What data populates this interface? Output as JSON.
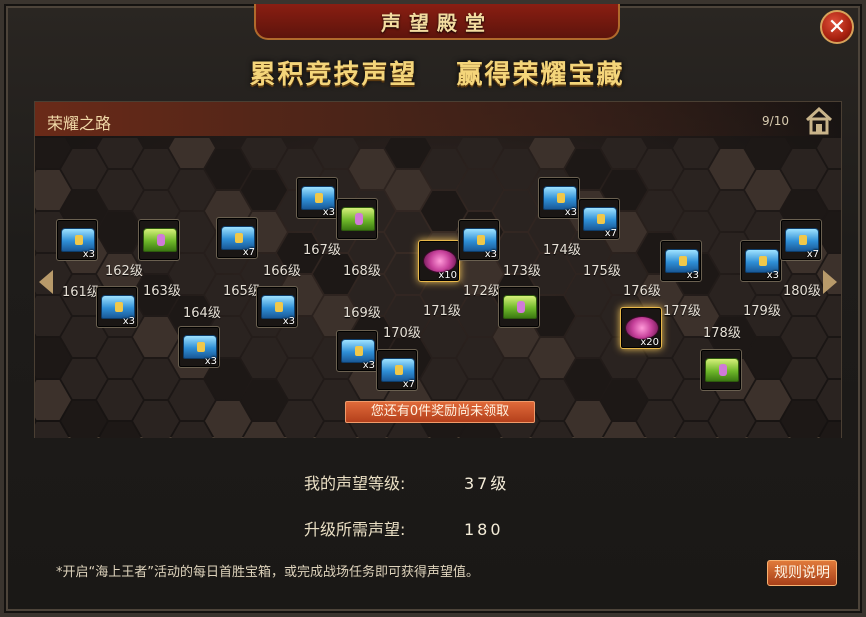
{
  "window": {
    "title": "声望殿堂",
    "close_symbol": "✕"
  },
  "headline": {
    "left": "累积竞技声望",
    "right": "赢得荣耀宝藏"
  },
  "panel": {
    "title": "荣耀之路",
    "page": "9/10"
  },
  "levels": [
    "161级",
    "162级",
    "163级",
    "164级",
    "165级",
    "166级",
    "167级",
    "168级",
    "169级",
    "170级",
    "171级",
    "172级",
    "173级",
    "174级",
    "175级",
    "176级",
    "177级",
    "178级",
    "179级",
    "180级"
  ],
  "rewards": [
    {
      "level": "161级",
      "chest": "blue",
      "qty": "x3"
    },
    {
      "level": "162级",
      "chest": "blue",
      "qty": "x3"
    },
    {
      "level": "163级",
      "chest": "green",
      "qty": ""
    },
    {
      "level": "164级",
      "chest": "blue",
      "qty": "x3"
    },
    {
      "level": "165级",
      "chest": "blue",
      "qty": "x7"
    },
    {
      "level": "166级",
      "chest": "blue",
      "qty": "x3"
    },
    {
      "level": "167级",
      "chest": "blue",
      "qty": "x3"
    },
    {
      "level": "168级",
      "chest": "green",
      "qty": ""
    },
    {
      "level": "169级",
      "chest": "blue",
      "qty": "x3"
    },
    {
      "level": "170级",
      "chest": "blue",
      "qty": "x7"
    },
    {
      "level": "171级",
      "chest": "pink",
      "qty": "x10"
    },
    {
      "level": "172级",
      "chest": "blue",
      "qty": "x3"
    },
    {
      "level": "173级",
      "chest": "green",
      "qty": ""
    },
    {
      "level": "174级",
      "chest": "blue",
      "qty": "x3"
    },
    {
      "level": "175级",
      "chest": "blue",
      "qty": "x7"
    },
    {
      "level": "176级",
      "chest": "pink",
      "qty": "x20"
    },
    {
      "level": "177级",
      "chest": "blue",
      "qty": "x3"
    },
    {
      "level": "178级",
      "chest": "green",
      "qty": ""
    },
    {
      "level": "179级",
      "chest": "blue",
      "qty": "x3"
    },
    {
      "level": "180级",
      "chest": "blue",
      "qty": "x7"
    }
  ],
  "unclaimed_button": "您还有0件奖励尚未领取",
  "stats": {
    "level_label": "我的声望等级:",
    "level_value": "37级",
    "need_label": "升级所需声望:",
    "need_value": "180"
  },
  "note": "*开启“海上王者”活动的每日首胜宝箱，或完成战场任务即可获得声望值。",
  "rules_button": "规则说明",
  "colors": {
    "accent": "#f4d57a",
    "button": "#b4401c",
    "frame": "#3a342e"
  }
}
